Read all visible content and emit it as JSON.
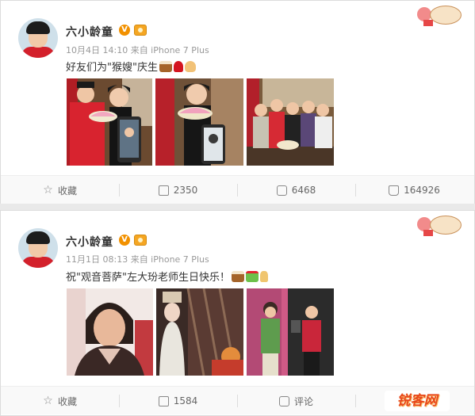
{
  "posts": [
    {
      "user": "六小龄童",
      "v_badge": "V",
      "meta": "10月4日 14:10 来自 iPhone 7 Plus",
      "text": "好友们为\"猴嫂\"庆生",
      "actions": {
        "favorite": "收藏",
        "repost": "2350",
        "comment": "6468",
        "like": "164926"
      }
    },
    {
      "user": "六小龄童",
      "v_badge": "V",
      "meta": "11月1日 08:13 来自 iPhone 7 Plus",
      "text": "祝\"观音菩萨\"左大玢老师生日快乐！",
      "actions": {
        "favorite": "收藏",
        "repost": "1584",
        "comment": "评论",
        "like": ""
      }
    }
  ],
  "watermark": "锐客网",
  "colors": {
    "accent": "#f29100",
    "link": "#eb7350",
    "shirt_red": "#d3202b"
  }
}
